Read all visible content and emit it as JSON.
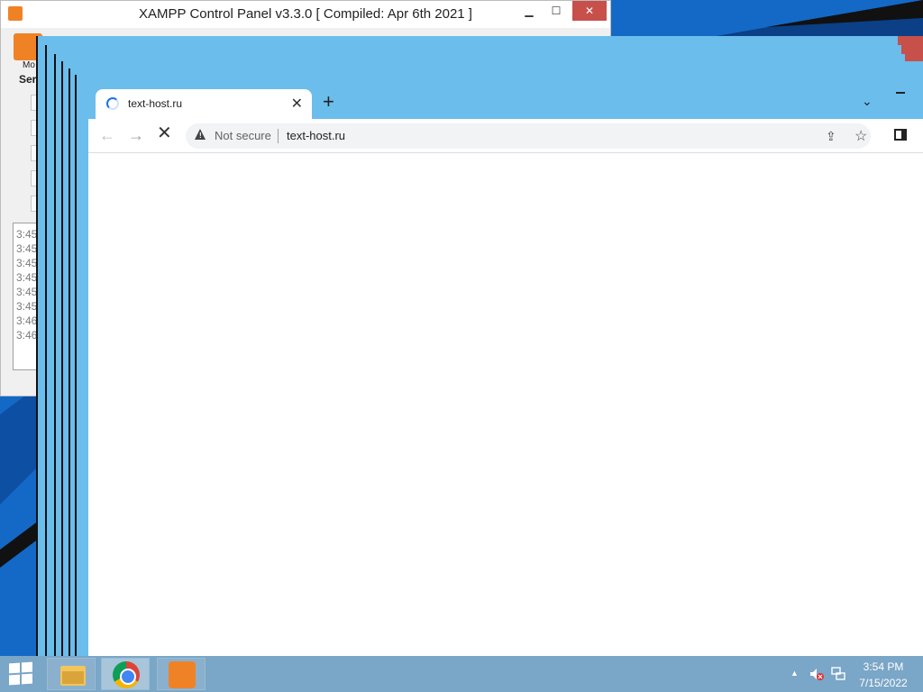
{
  "xampp": {
    "title": "XAMPP Control Panel v3.3.0   [ Compiled: Apr 6th 2021 ]",
    "minimize_glyph": "▁",
    "maximize_glyph": "☐",
    "close_glyph": "✕",
    "logo_label": "Mo",
    "services_label": "Ser",
    "log_lines": [
      "3:45",
      "3:45",
      "3:45",
      "3:45",
      "3:45",
      "3:45",
      "3:46",
      "3:46"
    ]
  },
  "browser": {
    "tab": {
      "title": "text-host.ru",
      "close_glyph": "✕"
    },
    "new_tab_glyph": "+",
    "tab_search_glyph": "⌄",
    "nav": {
      "back_glyph": "←",
      "forward_glyph": "→",
      "stop_glyph": "✕"
    },
    "omnibox": {
      "security_text": "Not secure",
      "url": "text-host.ru"
    },
    "share_glyph": "⇪",
    "star_glyph": "☆"
  },
  "taskbar": {
    "apps": [
      {
        "name": "File Explorer",
        "icon": "folder-icon"
      },
      {
        "name": "Google Chrome",
        "icon": "chrome-icon"
      },
      {
        "name": "XAMPP Control Panel",
        "icon": "xampp-icon"
      }
    ],
    "tray_arrow_glyph": "▲",
    "clock": {
      "time": "3:54 PM",
      "date": "7/15/2022"
    }
  },
  "colors": {
    "desktop": "#1469c7",
    "chrome_frame": "#6bbdec",
    "xampp_orange": "#f08226",
    "taskbar": "#7aa6c7"
  }
}
